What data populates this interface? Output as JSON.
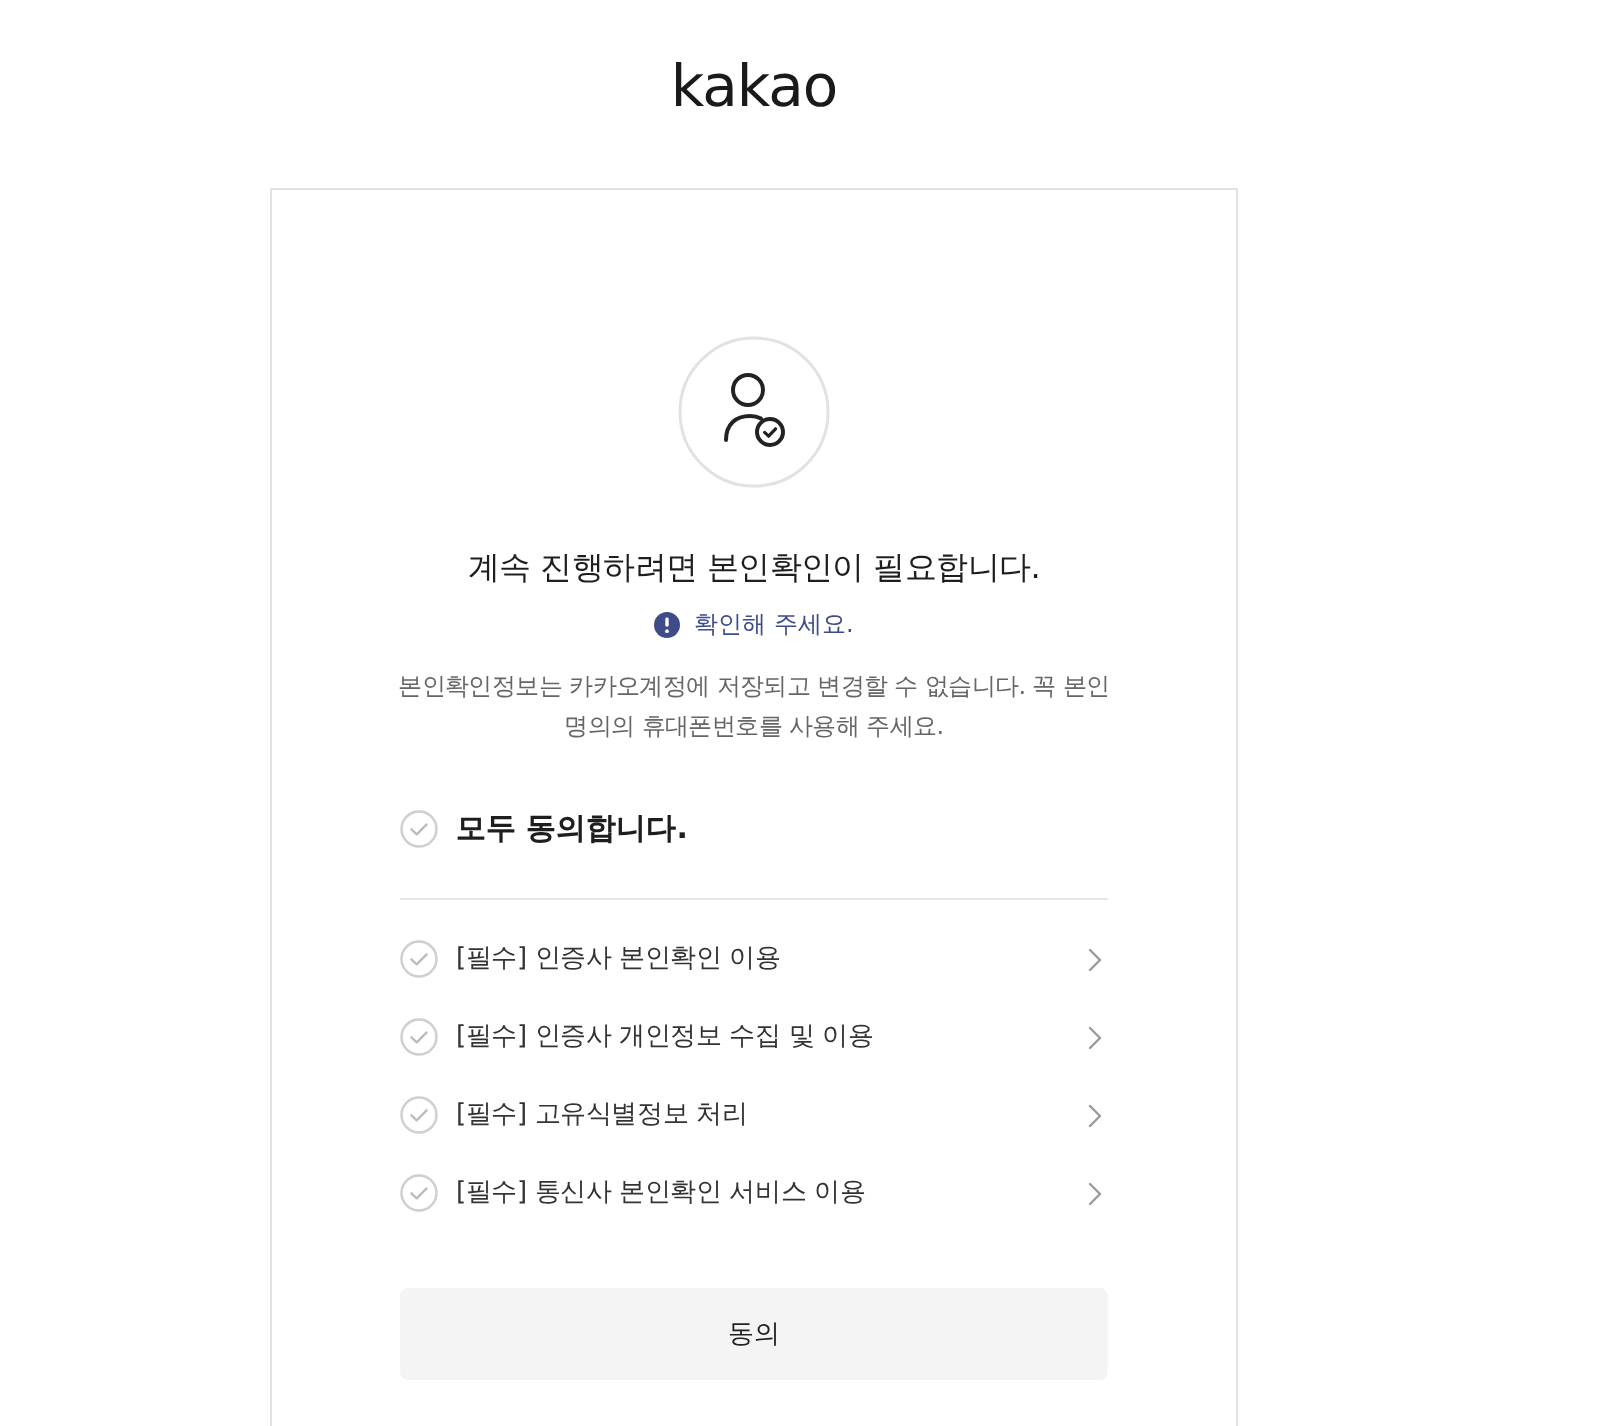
{
  "logo": {
    "text": "kakao"
  },
  "card": {
    "title": "계속 진행하려면 본인확인이 필요합니다.",
    "notice": "확인해 주세요.",
    "description": "본인확인정보는 카카오계정에 저장되고 변경할 수 없습니다. 꼭 본인 명의의 휴대폰번호를 사용해 주세요."
  },
  "agree_all": {
    "label": "모두 동의합니다.",
    "checked": false
  },
  "terms": [
    {
      "label": "[필수] 인증사 본인확인 이용",
      "checked": false
    },
    {
      "label": "[필수] 인증사 개인정보 수집 및 이용",
      "checked": false
    },
    {
      "label": "[필수] 고유식별정보 처리",
      "checked": false
    },
    {
      "label": "[필수] 통신사 본인확인 서비스 이용",
      "checked": false
    }
  ],
  "button": {
    "label": "동의"
  }
}
